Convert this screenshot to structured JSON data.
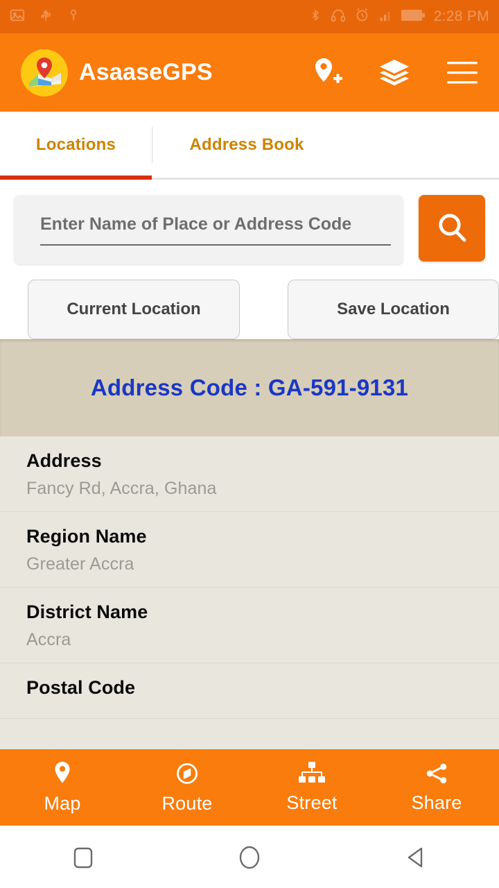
{
  "status_bar": {
    "time": "2:28 PM",
    "left_icons": [
      "image-icon",
      "usb-icon",
      "key-icon"
    ],
    "right_icons": [
      "bluetooth-icon",
      "headphones-icon",
      "alarm-icon",
      "signal-icon",
      "battery-icon"
    ]
  },
  "app_bar": {
    "title": "AsaaseGPS",
    "logo_icon": "map-pin-logo-icon",
    "actions": [
      {
        "icon": "add-location-icon"
      },
      {
        "icon": "layers-icon"
      },
      {
        "icon": "hamburger-menu-icon"
      }
    ]
  },
  "tabs": {
    "items": [
      {
        "label": "Locations",
        "active": true
      },
      {
        "label": "Address Book",
        "active": false
      }
    ]
  },
  "search": {
    "placeholder": "Enter Name of Place or Address Code",
    "value": "",
    "button_icon": "search-icon"
  },
  "actions": {
    "current_location_label": "Current Location",
    "save_location_label": "Save Location"
  },
  "address_code_banner": {
    "text": "Address Code : GA-591-9131",
    "label": "Address Code",
    "code": "GA-591-9131"
  },
  "details": [
    {
      "label": "Address",
      "value": "Fancy Rd, Accra, Ghana"
    },
    {
      "label": "Region Name",
      "value": "Greater Accra"
    },
    {
      "label": "District Name",
      "value": "Accra"
    },
    {
      "label": "Postal Code",
      "value": ""
    }
  ],
  "bottom_bar": [
    {
      "label": "Map",
      "icon": "map-pin-icon"
    },
    {
      "label": "Route",
      "icon": "compass-icon"
    },
    {
      "label": "Street",
      "icon": "sitemap-icon"
    },
    {
      "label": "Share",
      "icon": "share-nodes-icon"
    }
  ],
  "android_nav": [
    {
      "icon": "recents-square-icon"
    },
    {
      "icon": "home-circle-icon"
    },
    {
      "icon": "back-triangle-icon"
    }
  ],
  "colors": {
    "accent_orange": "#f97c0c",
    "status_orange": "#e8660a",
    "search_button": "#ed6c09",
    "tab_text": "#cc8400",
    "tab_indicator": "#d8300e",
    "code_text": "#1b37c4",
    "code_band_bg": "#d6ceb8",
    "list_bg": "#e8e6dd",
    "value_text": "#9b9b94"
  }
}
